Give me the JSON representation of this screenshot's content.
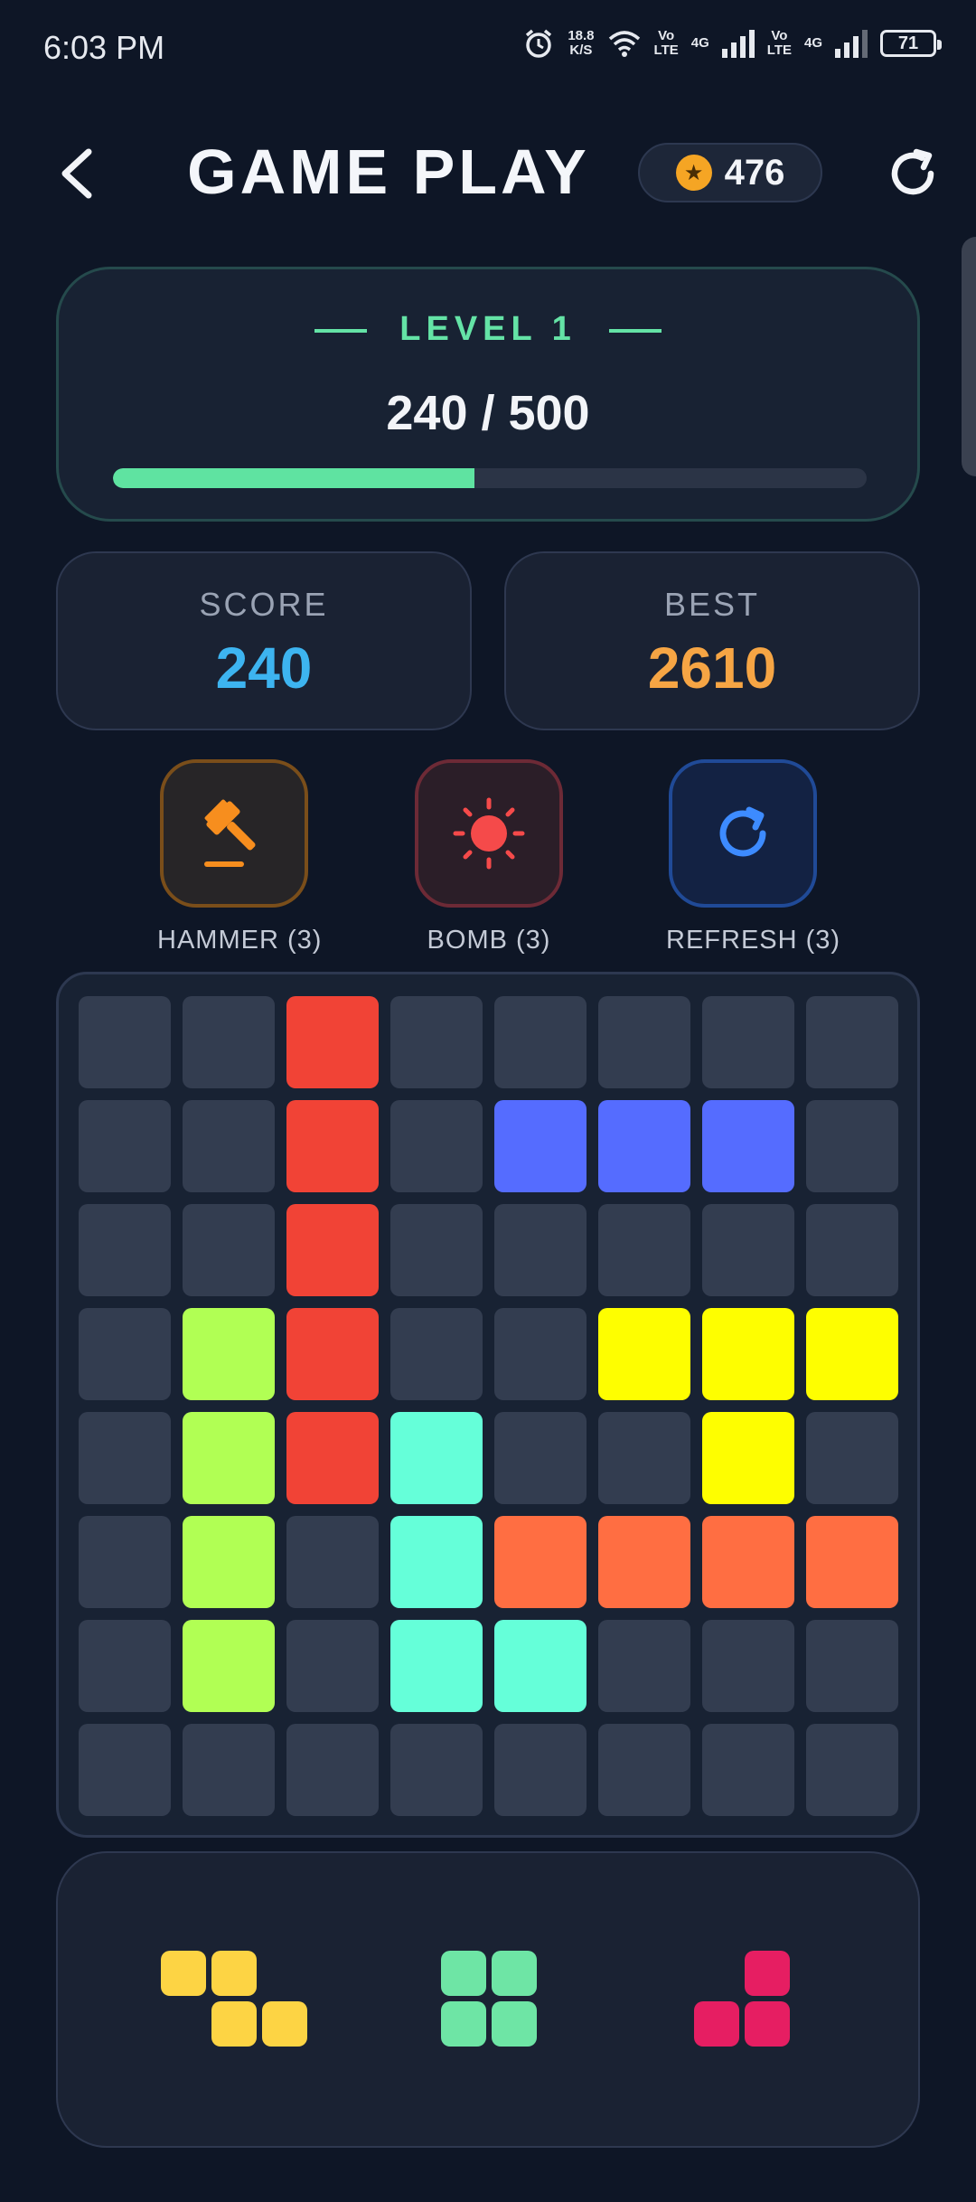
{
  "status_bar": {
    "time": "6:03 PM",
    "net_speed_top": "18.8",
    "net_speed_unit": "K/S",
    "sim1_vo": "Vo",
    "sim1_lte": "LTE",
    "sim1_gen": "4G",
    "sim2_vo": "Vo",
    "sim2_lte": "LTE",
    "sim2_gen": "4G",
    "battery": "71",
    "icons": [
      "alarm-icon",
      "wifi-icon",
      "signal-icon",
      "battery-icon"
    ]
  },
  "header": {
    "title": "GAME PLAY",
    "coins": "476",
    "back_icon": "chevron-left-icon",
    "restart_icon": "refresh-icon"
  },
  "level": {
    "title": "LEVEL 1",
    "progress_text": "240 / 500",
    "progress_fraction": 0.48
  },
  "stats": {
    "score_label": "SCORE",
    "score_value": "240",
    "best_label": "BEST",
    "best_value": "2610"
  },
  "powerups": {
    "hammer_label": "HAMMER (3)",
    "bomb_label": "BOMB (3)",
    "refresh_label": "REFRESH (3)"
  },
  "colors": {
    "empty": "#333d50",
    "R": "#f14336",
    "B": "#556cff",
    "G": "#b1ff54",
    "Y": "#fefe00",
    "C": "#65ffd9",
    "O": "#ff6e42",
    "score": "#3db4f0",
    "best": "#f6a544",
    "piece_yellow": "#fdd444",
    "piece_green": "#6ee5a5",
    "piece_pink": "#e61e62"
  },
  "board": [
    "..R.....",
    "..R.BBB.",
    "..R.....",
    ".GR..YYY",
    ".GRC..Y.",
    ".G.COOOO",
    ".G.CC...",
    "........"
  ],
  "tray_pieces": [
    {
      "color": "piece_yellow",
      "shape": [
        "XX.",
        ".XX"
      ]
    },
    {
      "color": "piece_green",
      "shape": [
        "XX",
        "XX"
      ]
    },
    {
      "color": "piece_pink",
      "shape": [
        ".X",
        "XX"
      ]
    }
  ]
}
